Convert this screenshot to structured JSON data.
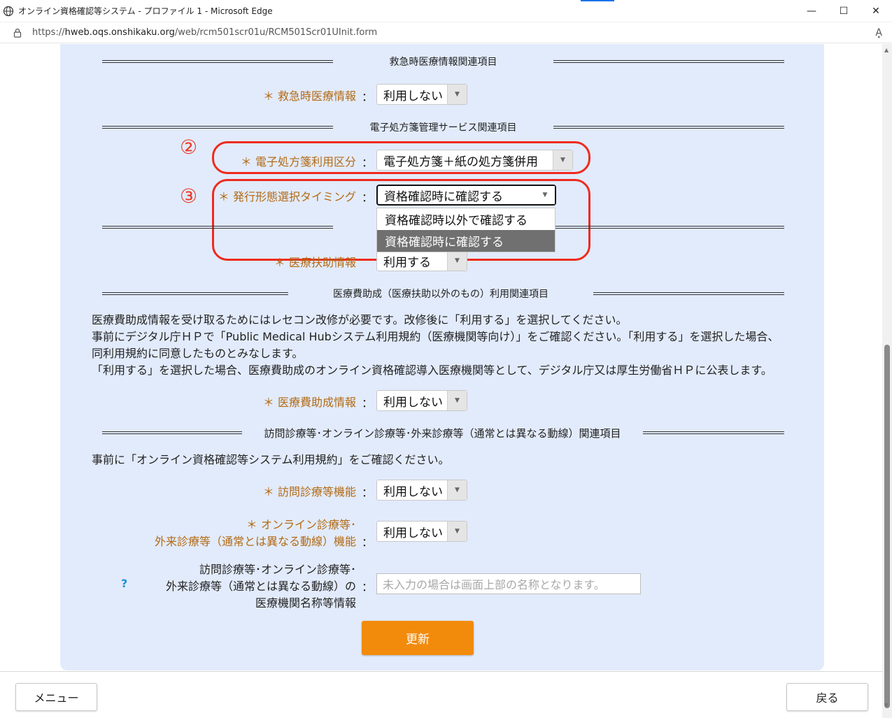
{
  "window": {
    "title": "オンライン資格確認等システム - プロファイル 1 - Microsoft Edge",
    "minimize": "—",
    "maximize": "☐",
    "close": "✕"
  },
  "address": {
    "prefix": "https://",
    "host": "hweb.oqs.onshikaku.org",
    "path": "/web/rcm501scr01u/RCM501Scr01UInit.form",
    "read_aloud": "A͓"
  },
  "sections": {
    "emergency": "救急時医療情報関連項目",
    "eprescription": "電子処方箋管理サービス関連項目",
    "subsidy": "医療費助成（医療扶助以外のもの）利用関連項目",
    "visit": "訪問診療等･オンライン診療等･外来診療等（通常とは異なる動線）関連項目"
  },
  "fields": {
    "emergency_info": {
      "label": "＊ 救急時医療情報",
      "value": "利用しない"
    },
    "eprescription_type": {
      "label": "＊ 電子処方箋利用区分",
      "value": "電子処方箋＋紙の処方箋併用"
    },
    "issue_timing": {
      "label": "＊ 発行形態選択タイミング",
      "value": "資格確認時に確認する",
      "options": [
        "資格確認時以外で確認する",
        "資格確認時に確認する"
      ]
    },
    "medical_aid": {
      "label": "＊ 医療扶助情報",
      "value": "利用する"
    },
    "subsidy_info": {
      "label": "＊ 医療費助成情報",
      "value": "利用しない"
    },
    "visit_function": {
      "label": "＊ 訪問診療等機能",
      "value": "利用しない"
    },
    "online_function": {
      "label_line1": "＊ オンライン診療等･",
      "label_line2": "外来診療等（通常とは異なる動線）機能",
      "value": "利用しない"
    },
    "facility_name": {
      "label_line1": "訪問診療等･オンライン診療等･",
      "label_line2": "外来診療等（通常とは異なる動線）の",
      "label_line3": "医療機関名称等情報",
      "placeholder": "未入力の場合は画面上部の名称となります。",
      "help": "?"
    }
  },
  "colon": "：",
  "annotations": {
    "num2": "②",
    "num3": "③"
  },
  "paragraphs": {
    "subsidy_1": "医療費助成情報を受け取るためにはレセコン改修が必要です。改修後に「利用する」を選択してください。",
    "subsidy_2": "事前にデジタル庁ＨＰで「Public Medical Hubシステム利用規約（医療機関等向け）」をご確認ください。「利用する」を選択した場合、",
    "subsidy_3": "同利用規約に同意したものとみなします。",
    "subsidy_4": "「利用する」を選択した場合、医療費助成のオンライン資格確認導入医療機関等として、デジタル庁又は厚生労働省ＨＰに公表します。",
    "visit_1": "事前に「オンライン資格確認等システム利用規約」をご確認ください。"
  },
  "buttons": {
    "update": "更新",
    "menu": "メニュー",
    "back": "戻る"
  },
  "colors": {
    "accent": "#f28b0c",
    "label": "#b36a14",
    "callout": "#ee2b1e",
    "panel": "#e2ebfb"
  }
}
